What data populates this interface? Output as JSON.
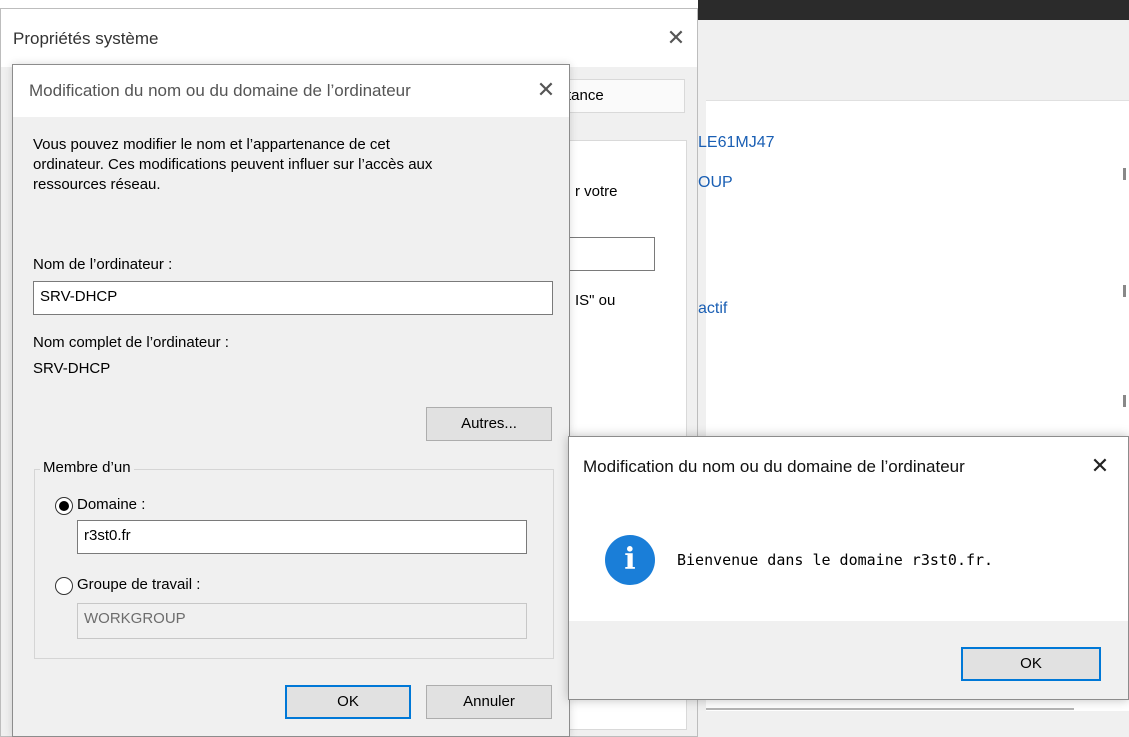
{
  "background_window": {
    "values": [
      "LE61MJ47",
      "OUP",
      "actif"
    ]
  },
  "properties_window": {
    "title": "Propriétés système",
    "tab_fragment": "tance",
    "text_fragments": [
      "r votre",
      "IS\" ou"
    ]
  },
  "computer_name_dialog": {
    "title": "Modification du nom ou du domaine de l’ordinateur",
    "description": "Vous pouvez modifier le nom et l’appartenance de cet ordinateur. Ces modifications peuvent influer sur l’accès aux ressources réseau.",
    "description_lines": [
      "Vous pouvez modifier le nom et l’appartenance de cet",
      "ordinateur. Ces modifications peuvent influer sur l’accès aux",
      "ressources réseau."
    ],
    "computer_name_label": "Nom de l’ordinateur :",
    "computer_name_value": "SRV-DHCP",
    "full_name_label": "Nom complet de l’ordinateur :",
    "full_name_value": "SRV-DHCP",
    "more_button": "Autres...",
    "member_of_label": "Membre d’un",
    "domain_label": "Domaine :",
    "domain_value": "r3st0.fr",
    "workgroup_label": "Groupe de travail :",
    "workgroup_value": "WORKGROUP",
    "ok_button": "OK",
    "cancel_button": "Annuler"
  },
  "message_box": {
    "title": "Modification du nom ou du domaine de l’ordinateur",
    "icon": "info-icon",
    "icon_glyph": "i",
    "message": "Bienvenue dans le domaine r3st0.fr.",
    "ok_button": "OK"
  },
  "colors": {
    "accent": "#0078d7",
    "link": "#1a5fb4",
    "info_icon": "#1a7ed8"
  }
}
